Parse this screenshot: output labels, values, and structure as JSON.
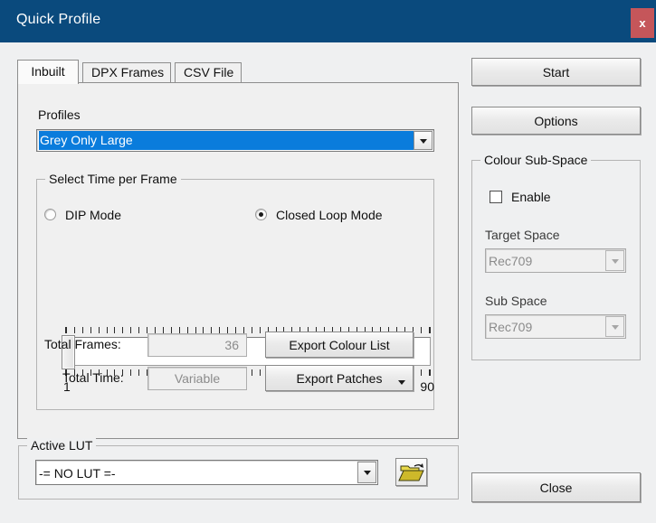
{
  "window": {
    "title": "Quick Profile",
    "close_label": "x"
  },
  "tabs": [
    {
      "label": "Inbuilt",
      "active": true
    },
    {
      "label": "DPX Frames",
      "active": false
    },
    {
      "label": "CSV File",
      "active": false
    }
  ],
  "inbuilt": {
    "profiles_label": "Profiles",
    "profile_value": "Grey Only Large",
    "time_group_title": "Select Time per Frame",
    "radio_dip": "DIP Mode",
    "radio_closed_loop": "Closed Loop Mode",
    "radio_selected": "Closed Loop Mode",
    "slider": {
      "min_label": "1",
      "max_label": "90",
      "value": 1,
      "min": 1,
      "max": 90
    },
    "total_frames_label": "Total Frames:",
    "total_frames_value": "36",
    "total_time_label": "Total Time:",
    "total_time_value": "Variable",
    "export_colour_list": "Export Colour List",
    "export_patches": "Export Patches"
  },
  "active_lut": {
    "group_title": "Active LUT",
    "value": "-= NO LUT =-",
    "browse_icon": "open-folder-icon"
  },
  "right_panel": {
    "start": "Start",
    "options": "Options",
    "close": "Close",
    "colour_subspace": {
      "group_title": "Colour Sub-Space",
      "enable_label": "Enable",
      "enable_checked": false,
      "target_space_label": "Target Space",
      "target_space_value": "Rec709",
      "sub_space_label": "Sub Space",
      "sub_space_value": "Rec709"
    }
  },
  "colors": {
    "titlebar": "#0a4a7d",
    "close_button": "#c5565a",
    "selection": "#0a7cdc",
    "dialog_bg": "#eff0f1",
    "panel_bg": "#f0f0f0"
  }
}
